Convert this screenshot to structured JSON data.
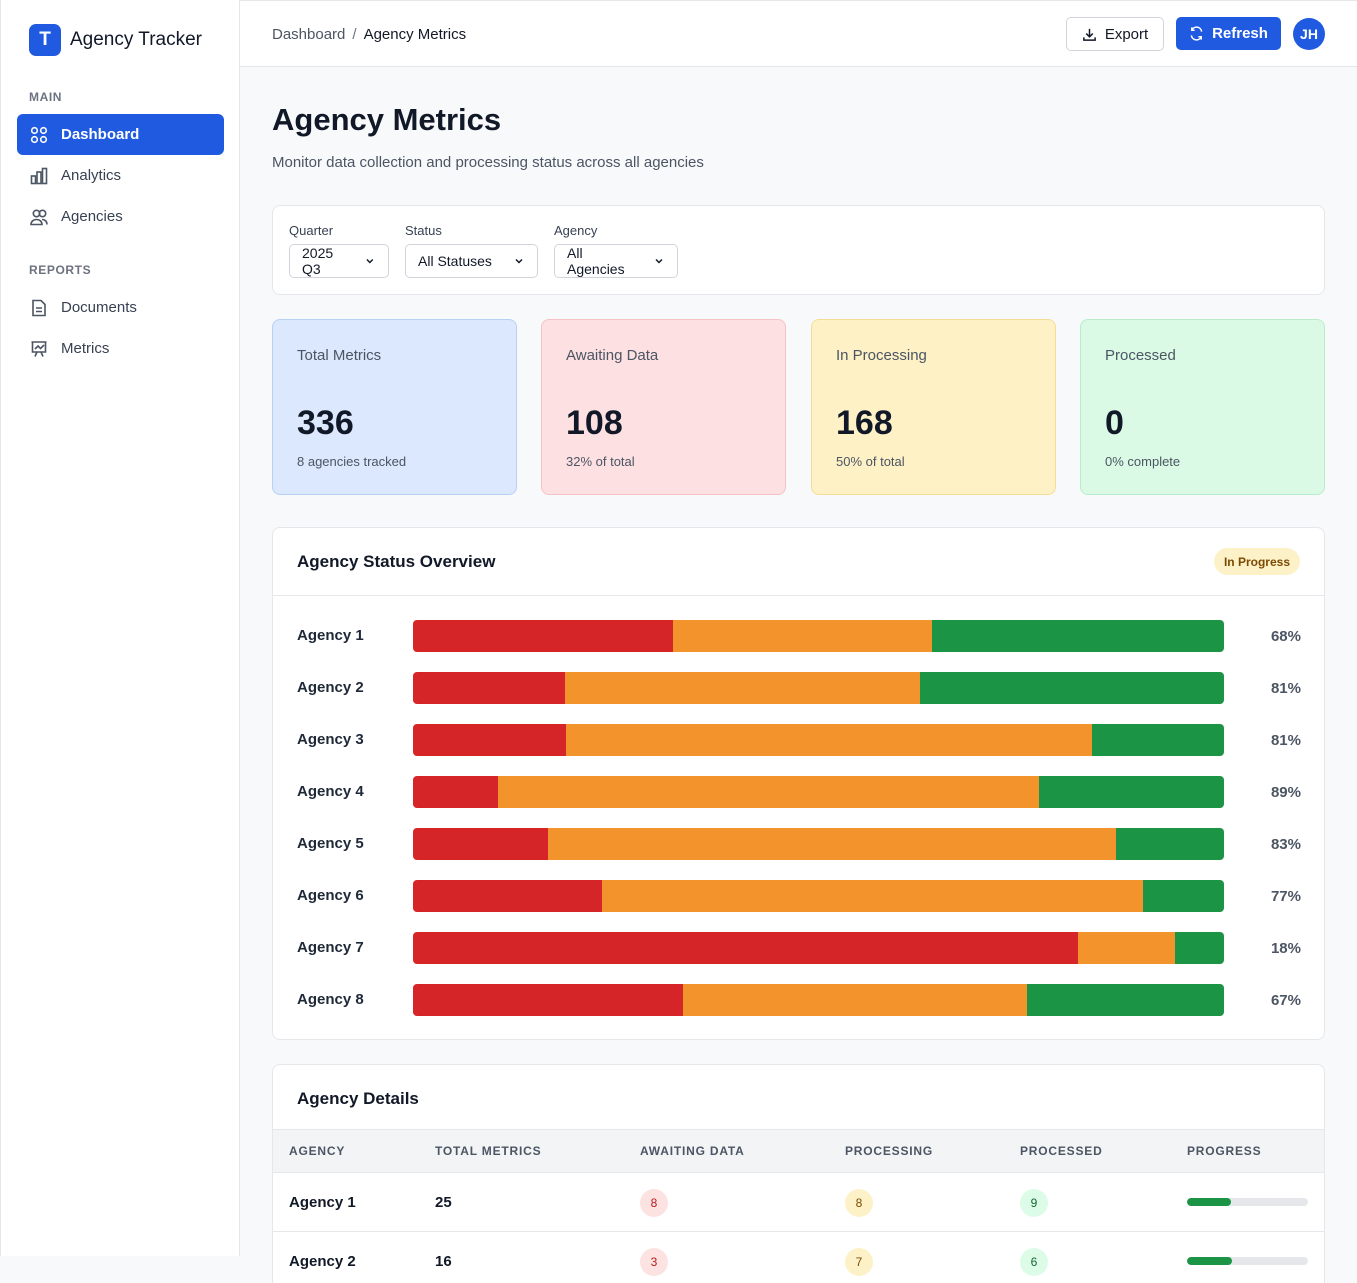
{
  "app": {
    "logo_letter": "T",
    "name": "Agency Tracker"
  },
  "sidebar": {
    "sections": [
      {
        "title": "MAIN",
        "items": [
          {
            "label": "Dashboard",
            "icon": "grid-icon",
            "active": true
          },
          {
            "label": "Analytics",
            "icon": "bar-chart-icon",
            "active": false
          },
          {
            "label": "Agencies",
            "icon": "users-icon",
            "active": false
          }
        ]
      },
      {
        "title": "REPORTS",
        "items": [
          {
            "label": "Documents",
            "icon": "document-icon",
            "active": false
          },
          {
            "label": "Metrics",
            "icon": "presentation-chart-icon",
            "active": false
          }
        ]
      }
    ]
  },
  "header": {
    "breadcrumb": [
      "Dashboard",
      "Agency Metrics"
    ],
    "separator": "/",
    "export_label": "Export",
    "refresh_label": "Refresh",
    "avatar_initials": "JH"
  },
  "page": {
    "title": "Agency Metrics",
    "subtitle": "Monitor data collection and processing status across all agencies"
  },
  "filters": [
    {
      "label": "Quarter",
      "value": "2025 Q3"
    },
    {
      "label": "Status",
      "value": "All Statuses"
    },
    {
      "label": "Agency",
      "value": "All Agencies"
    }
  ],
  "cards": [
    {
      "label": "Total Metrics",
      "value": "336",
      "note": "8 agencies tracked",
      "bg": "#dbe8fd",
      "border": "#b9d0f5"
    },
    {
      "label": "Awaiting Data",
      "value": "108",
      "note": "32% of total",
      "bg": "#fde0e2",
      "border": "#f6c2c6"
    },
    {
      "label": "In Processing",
      "value": "168",
      "note": "50% of total",
      "bg": "#fef1c6",
      "border": "#f3dd95"
    },
    {
      "label": "Processed",
      "value": "0",
      "note": "0% complete",
      "bg": "#dbfae6",
      "border": "#b8eccb"
    }
  ],
  "status_overview": {
    "title": "Agency Status Overview",
    "badge": "In Progress",
    "colors": {
      "awaiting": "#d62528",
      "processing": "#f2932b",
      "processed": "#1b9446"
    },
    "rows": [
      {
        "name": "Agency 1",
        "awaiting": 0.32,
        "processing": 0.32,
        "processed": 0.36,
        "pct": "68%"
      },
      {
        "name": "Agency 2",
        "awaiting": 0.187,
        "processing": 0.438,
        "processed": 0.375,
        "pct": "81%"
      },
      {
        "name": "Agency 3",
        "awaiting": 0.189,
        "processing": 0.648,
        "processed": 0.163,
        "pct": "81%"
      },
      {
        "name": "Agency 4",
        "awaiting": 0.105,
        "processing": 0.667,
        "processed": 0.228,
        "pct": "89%"
      },
      {
        "name": "Agency 5",
        "awaiting": 0.167,
        "processing": 0.7,
        "processed": 0.133,
        "pct": "83%"
      },
      {
        "name": "Agency 6",
        "awaiting": 0.233,
        "processing": 0.667,
        "processed": 0.1,
        "pct": "77%"
      },
      {
        "name": "Agency 7",
        "awaiting": 0.82,
        "processing": 0.12,
        "processed": 0.06,
        "pct": "18%"
      },
      {
        "name": "Agency 8",
        "awaiting": 0.333,
        "processing": 0.424,
        "processed": 0.243,
        "pct": "67%"
      }
    ]
  },
  "details": {
    "title": "Agency Details",
    "columns": [
      "AGENCY",
      "TOTAL METRICS",
      "AWAITING DATA",
      "PROCESSING",
      "PROCESSED",
      "PROGRESS"
    ],
    "rows": [
      {
        "agency": "Agency 1",
        "total": "25",
        "awaiting": "8",
        "processing": "8",
        "processed": "9",
        "progress": 0.36
      },
      {
        "agency": "Agency 2",
        "total": "16",
        "awaiting": "3",
        "processing": "7",
        "processed": "6",
        "progress": 0.375
      }
    ]
  }
}
